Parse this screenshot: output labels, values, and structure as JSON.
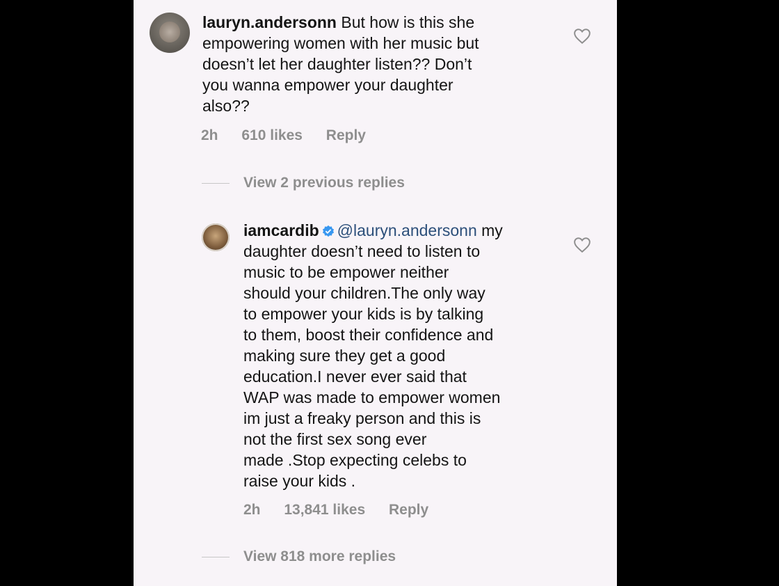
{
  "comment": {
    "username": "lauryn.andersonn",
    "text_first": "But how is this she",
    "text_rest": "empowering women with her music but\ndoesn’t let her daughter listen?? Don’t\nyou wanna empower your daughter\nalso??",
    "time": "2h",
    "likes": "610 likes",
    "reply_label": "Reply"
  },
  "view_previous": "View 2 previous replies",
  "reply": {
    "username": "iamcardib",
    "mention": "@lauryn.andersonn",
    "text_first": "my",
    "text_rest": "daughter doesn’t need to listen to\nmusic to be empower neither\nshould your children.The only way\nto empower your kids is by talking\nto them, boost their confidence and\nmaking sure they get a good\neducation.I never ever said that\nWAP was made to empower women\nim just a freaky person and this is\nnot the first sex song ever\nmade .Stop expecting celebs to\nraise your kids .",
    "time": "2h",
    "likes": "13,841 likes",
    "reply_label": "Reply"
  },
  "view_more": "View 818 more replies",
  "icons": {
    "like": "heart-outline-icon",
    "verified": "verified-badge-icon"
  },
  "colors": {
    "background": "#000000",
    "panel": "#f8f4f8",
    "mention": "#2c4f7a",
    "verified": "#3897f0",
    "meta": "#8e8e8e"
  }
}
